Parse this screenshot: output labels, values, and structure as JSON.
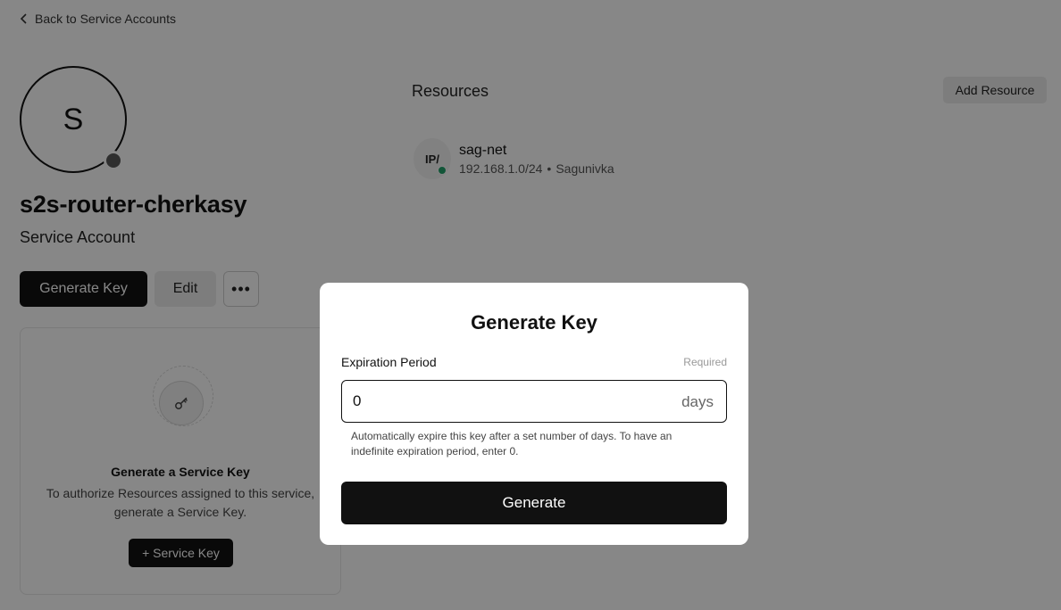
{
  "nav": {
    "back_label": "Back to Service Accounts"
  },
  "account": {
    "avatar_letter": "S",
    "name": "s2s-router-cherkasy",
    "type_label": "Service Account",
    "status_color": "#5a5a5a"
  },
  "actions": {
    "generate_key_label": "Generate Key",
    "edit_label": "Edit",
    "more_label": "•••"
  },
  "empty_state": {
    "icon": "key-icon",
    "title": "Generate a Service Key",
    "description": "To authorize Resources assigned to this service, generate a Service Key.",
    "button_label": "+ Service Key"
  },
  "resources": {
    "heading": "Resources",
    "add_label": "Add Resource",
    "items": [
      {
        "icon_text": "IP/",
        "name": "sag-net",
        "address": "192.168.1.0/24",
        "separator": "•",
        "network": "Sagunivka",
        "status_color": "#22a06b"
      }
    ]
  },
  "modal": {
    "title": "Generate Key",
    "field_label": "Expiration Period",
    "field_required": "Required",
    "field_value": "0",
    "field_suffix": "days",
    "help_text": "Automatically expire this key after a set number of days. To have an indefinite expiration period, enter 0.",
    "submit_label": "Generate"
  },
  "colors": {
    "primary": "#111111",
    "overlay": "rgba(0,0,0,0.47)",
    "online": "#22a06b"
  }
}
